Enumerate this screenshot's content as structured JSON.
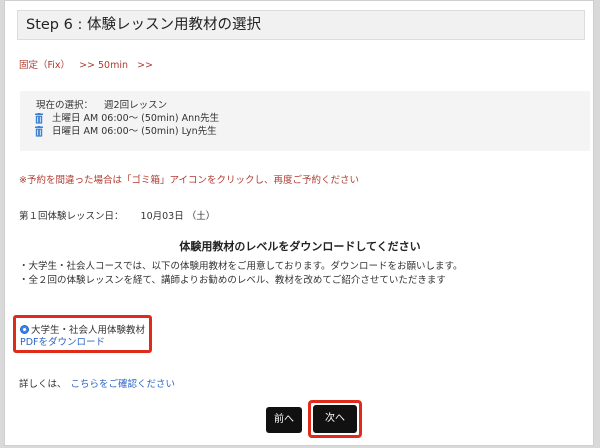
{
  "header": {
    "title": "Step 6 : 体験レッスン用教材の選択"
  },
  "breadcrumb": {
    "plan": "固定（Fix）",
    "duration": ">> 50min",
    "arrow": ">>"
  },
  "selection": {
    "label": "現在の選択：",
    "value": "週2回レッスン",
    "slots": [
      {
        "text": "土曜日 AM 06:00〜 (50min) Ann先生"
      },
      {
        "text": "日曜日 AM 06:00〜 (50min) Lyn先生"
      }
    ]
  },
  "warning": "※予約を間違った場合は「ゴミ箱」アイコンをクリックし、再度ご予約ください",
  "first_lesson": {
    "label": "第１回体験レッスン日：",
    "date": "10月03日 （土）"
  },
  "download": {
    "heading": "体験用教材のレベルをダウンロードしてください",
    "bullets": [
      "・大学生・社会人コースでは、以下の体験用教材をご用意しております。ダウンロードをお願いします。",
      "・全２回の体験レッスンを経て、講師よりお勧めのレベル、教材を改めてご紹介させていただきます"
    ],
    "material_label": "大学生・社会人用体験教材",
    "pdf_link": "PDFをダウンロード"
  },
  "details": {
    "label": "詳しくは、",
    "link": "こちらをご確認ください"
  },
  "buttons": {
    "prev": "前へ",
    "next": "次へ"
  },
  "colors": {
    "accent_red": "#e02a1c",
    "link_blue": "#2a64c7",
    "warning_red": "#b03a2e",
    "button_black": "#111111"
  },
  "icons": {
    "slot_icon": "trash-icon"
  }
}
